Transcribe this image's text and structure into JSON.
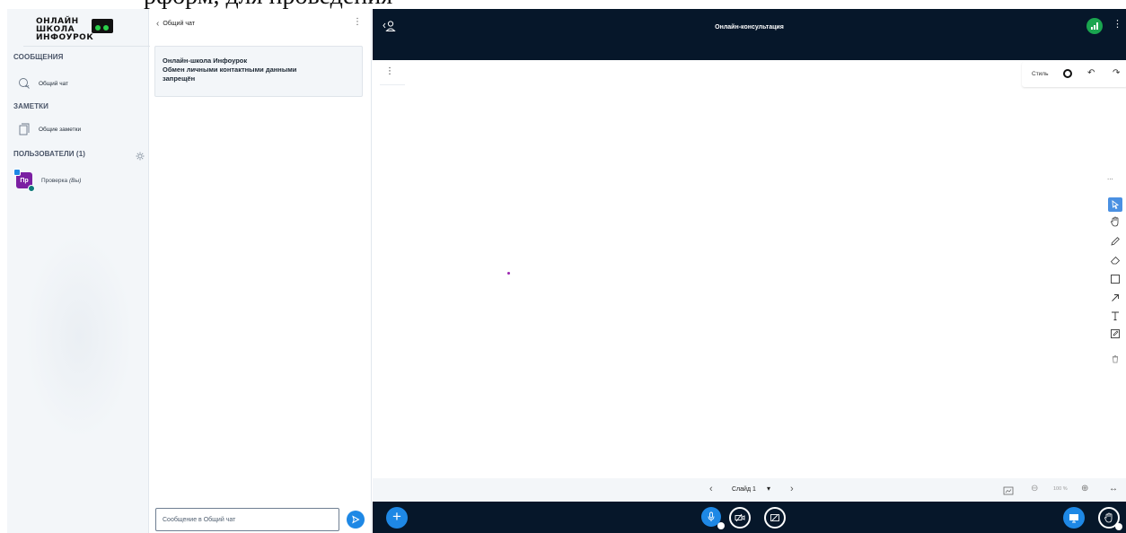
{
  "top_strip": {
    "text": "рформ, для проведения"
  },
  "logo": {
    "line1": "ОНЛАЙН",
    "line2": "ШКОЛА",
    "line3": "ИНФОУРОК"
  },
  "sidebar": {
    "messages_title": "СООБЩЕНИЯ",
    "public_chat_label": "Общий чат",
    "notes_title": "ЗАМЕТКИ",
    "shared_notes_label": "Общие заметки",
    "users_title": "ПОЛЬЗОВАТЕЛИ (1)",
    "user": {
      "initials": "Пр",
      "name": "Проверка",
      "you_tag": "(Вы)"
    }
  },
  "chat": {
    "header_title": "Общий чат",
    "welcome_line1": "Онлайн-школа Инфоурок",
    "welcome_line2": "Обмен личными контактными данными",
    "welcome_line3": "запрещён",
    "input_placeholder": "Сообщение в Общий чат"
  },
  "topbar": {
    "title": "Онлайн-консультация"
  },
  "whiteboard": {
    "style_label": "Стиль",
    "more_label": "...",
    "tools": [
      "pointer-icon",
      "hand-icon",
      "pencil-icon",
      "eraser-icon",
      "rectangle-icon",
      "arrow-icon",
      "text-icon",
      "note-icon",
      "trash-icon"
    ],
    "accent_color": "#4a90e2"
  },
  "bottom_nav": {
    "slide_label": "Слайд 1",
    "zoom_value": "100 %"
  },
  "colors": {
    "topbar_bg": "#06172a",
    "primary": "#1e88e5",
    "connection_ok": "#1aa54f",
    "avatar": "#7b1fa2"
  }
}
